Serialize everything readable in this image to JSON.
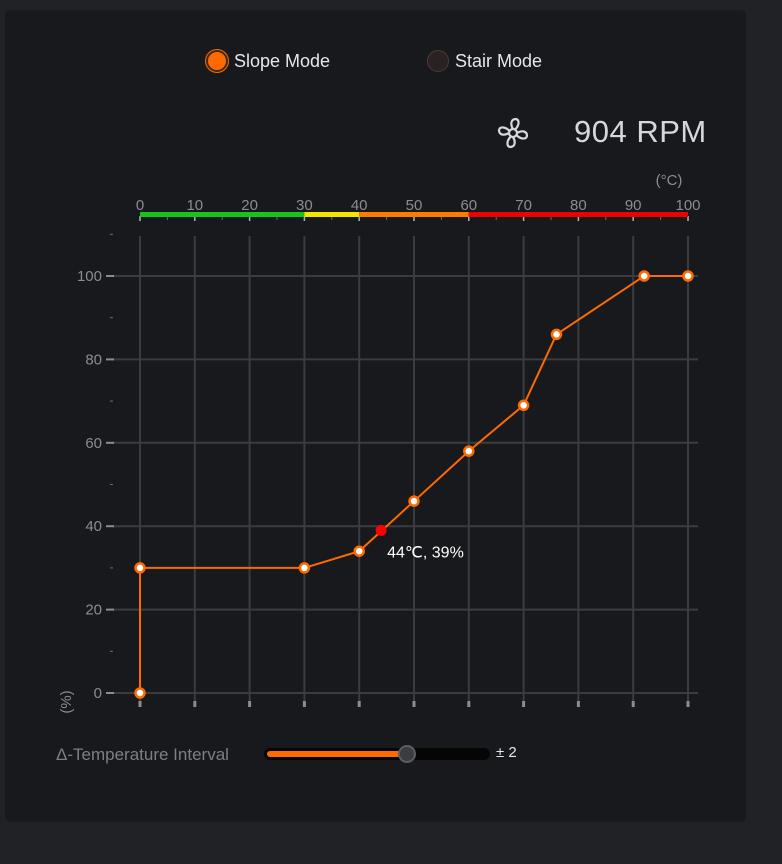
{
  "modes": {
    "slope": {
      "label": "Slope Mode",
      "selected": true
    },
    "stair": {
      "label": "Stair Mode",
      "selected": false
    }
  },
  "fan": {
    "icon": "fan-icon",
    "rpm_text": "904 RPM"
  },
  "chart_data": {
    "type": "line",
    "x_unit": "(°C)",
    "y_unit": "(%)",
    "xlim": [
      0,
      100
    ],
    "ylim": [
      0,
      100
    ],
    "x_ticks": [
      0,
      10,
      20,
      30,
      40,
      50,
      60,
      70,
      80,
      90,
      100
    ],
    "y_ticks": [
      0,
      20,
      40,
      60,
      80,
      100
    ],
    "grid": true,
    "temperature_bands": [
      {
        "from": 0,
        "to": 30,
        "color": "#19c41a"
      },
      {
        "from": 30,
        "to": 40,
        "color": "#f5e400"
      },
      {
        "from": 40,
        "to": 60,
        "color": "#ff7a00"
      },
      {
        "from": 60,
        "to": 100,
        "color": "#ee0000"
      }
    ],
    "series": [
      {
        "x": [
          0,
          0,
          30,
          40,
          50,
          60,
          70,
          76,
          92,
          100
        ],
        "y": [
          0,
          30,
          30,
          34,
          46,
          58,
          69,
          86,
          100,
          100
        ],
        "color": "#ff6a00"
      }
    ],
    "current_point": {
      "x": 44,
      "y": 39,
      "label": "44℃, 39%",
      "color": "#ff0000"
    }
  },
  "slider": {
    "label": "Δ-Temperature Interval",
    "value_text": "± 2",
    "fraction": 0.65
  }
}
